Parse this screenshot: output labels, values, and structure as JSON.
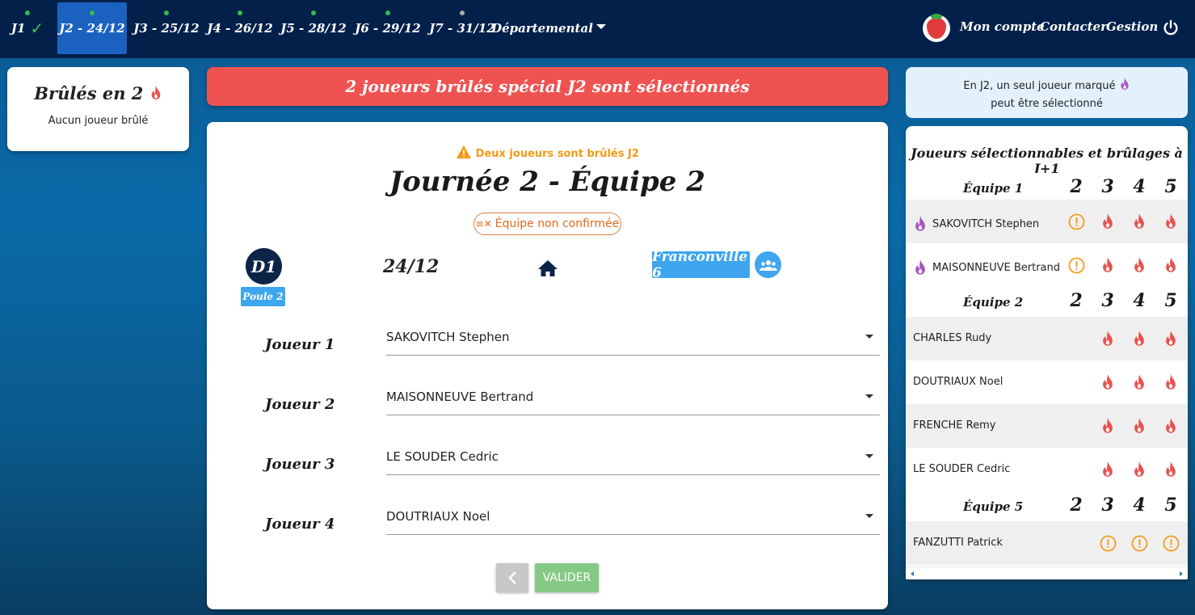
{
  "nav": {
    "tabs": [
      {
        "label": "J1",
        "dot": "#2fbf4a",
        "checked": true
      },
      {
        "label": "J2 - 24/12",
        "dot": "#2fbf4a"
      },
      {
        "label": "J3 - 25/12",
        "dot": "#2fbf4a"
      },
      {
        "label": "J4 - 26/12",
        "dot": "#2fbf4a"
      },
      {
        "label": "J5 - 28/12",
        "dot": "#2fbf4a"
      },
      {
        "label": "J6 - 29/12",
        "dot": "#2fbf4a"
      },
      {
        "label": "J7 - 31/12",
        "dot": "#aaaaaa"
      }
    ],
    "dept_label": "Départemental",
    "account_label": "Mon compte",
    "contact_label": "Contacter",
    "manage_label": "Gestion"
  },
  "burned": {
    "title": "Brûlés en 2",
    "empty": "Aucun joueur brûlé"
  },
  "banner": "2 joueurs brûlés spécial J2 sont sélectionnés",
  "match": {
    "warning": "Deux joueurs sont brûlés J2",
    "title": "Journée 2 - Équipe 2",
    "status": "Équipe non confirmée",
    "division": "D1",
    "poule": "Poule 2",
    "date": "24/12",
    "opponent": "Franconville 6",
    "players": [
      {
        "label": "Joueur 1",
        "value": "SAKOVITCH Stephen"
      },
      {
        "label": "Joueur 2",
        "value": "MAISONNEUVE Bertrand"
      },
      {
        "label": "Joueur 3",
        "value": "LE SOUDER Cedric"
      },
      {
        "label": "Joueur 4",
        "value": "DOUTRIAUX Noel"
      }
    ],
    "validate_label": "VALIDER"
  },
  "info": {
    "line1": "En J2, un seul joueur marqué",
    "line2": "peut être sélectionné"
  },
  "selectable": {
    "title": "Joueurs sélectionnables et brûlages à J+1",
    "columns": [
      "2",
      "3",
      "4",
      "5"
    ],
    "teams": [
      {
        "name": "Équipe 1",
        "players": [
          {
            "name": "SAKOVITCH Stephen",
            "special": true,
            "cells": [
              "warn",
              "fire",
              "fire",
              "fire"
            ]
          },
          {
            "name": "MAISONNEUVE Bertrand",
            "special": true,
            "cells": [
              "warn",
              "fire",
              "fire",
              "fire"
            ]
          }
        ]
      },
      {
        "name": "Équipe 2",
        "players": [
          {
            "name": "CHARLES Rudy",
            "special": false,
            "cells": [
              "",
              "fire",
              "fire",
              "fire"
            ]
          },
          {
            "name": "DOUTRIAUX Noel",
            "special": false,
            "cells": [
              "",
              "fire",
              "fire",
              "fire"
            ]
          },
          {
            "name": "FRENCHE Remy",
            "special": false,
            "cells": [
              "",
              "fire",
              "fire",
              "fire"
            ]
          },
          {
            "name": "LE SOUDER Cedric",
            "special": false,
            "cells": [
              "",
              "fire",
              "fire",
              "fire"
            ]
          }
        ]
      },
      {
        "name": "Équipe 5",
        "players": [
          {
            "name": "FANZUTTI Patrick",
            "special": false,
            "cells": [
              "",
              "warn",
              "warn",
              "warn"
            ]
          }
        ]
      }
    ]
  },
  "colors": {
    "fire": "#e8524f",
    "warn": "#f39a16",
    "special": "#a855c4",
    "accent": "#3ea6ee"
  }
}
